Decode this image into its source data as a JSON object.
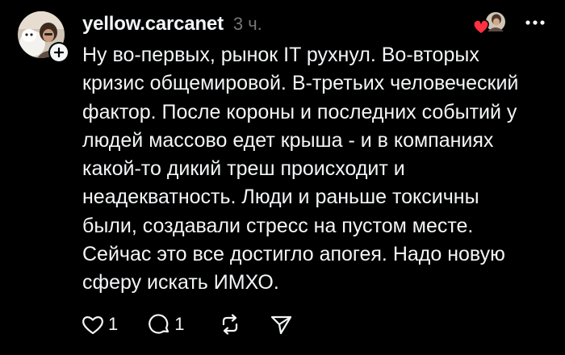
{
  "post": {
    "author": "yellow.carcanet",
    "time": "3 ч.",
    "text": "Ну во-первых, рынок IT рухнул. Во-вторых\nкризис общемировой. В-третьих человеческий\nфактор. После короны и последних событий у\nлюдей массово едет крыша - и в компаниях\nкакой-то дикий треш происходит и\nнеадекватность. Люди и раньше токсичны\nбыли, создавали стресс на пустом месте.\nСейчас это все достигло апогея. Надо новую\nсферу искать ИМХО."
  },
  "actions": {
    "like_count": "1",
    "reply_count": "1"
  },
  "icons": {
    "follow": "plus-icon",
    "liked_by": "heart-icon",
    "more": "more-icon",
    "like": "heart-icon",
    "reply": "comment-icon",
    "repost": "repost-icon",
    "share": "send-icon"
  },
  "colors": {
    "background": "#000000",
    "text": "#f3f5f7",
    "muted": "#777777",
    "like_heart": "#ff3040"
  }
}
